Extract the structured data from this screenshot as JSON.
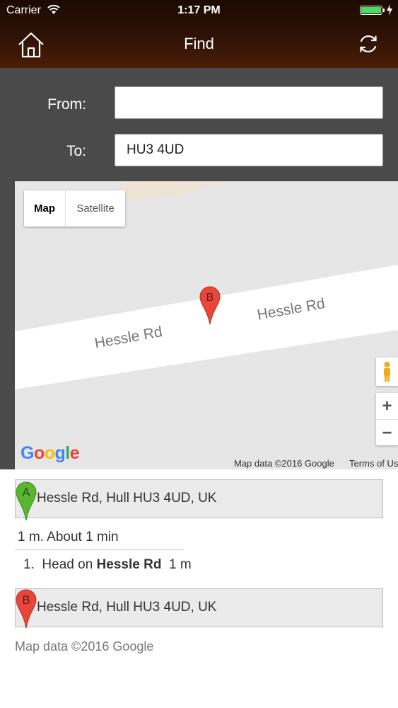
{
  "status_bar": {
    "carrier": "Carrier",
    "time": "1:17 PM",
    "battery_color": "#4cd964"
  },
  "nav": {
    "title": "Find",
    "home_icon": "home-icon",
    "refresh_icon": "refresh-icon"
  },
  "form": {
    "from_label": "From:",
    "from_value": "",
    "to_label": "To:",
    "to_value": "HU3 4UD"
  },
  "map": {
    "type_map": "Map",
    "type_satellite": "Satellite",
    "road_label_1": "Hessle Rd",
    "road_label_2": "Hessle Rd",
    "pin_label": "B",
    "logo": {
      "g1": "G",
      "o1": "o",
      "o2": "o",
      "g2": "g",
      "l": "l",
      "e": "e"
    },
    "attribution": "Map data ©2016 Google",
    "terms": "Terms of Us",
    "zoom_in": "+",
    "zoom_out": "−"
  },
  "directions": {
    "start": {
      "marker": "A",
      "address": "Hessle Rd, Hull HU3 4UD, UK",
      "color": "#5ab531"
    },
    "summary": "1 m. About 1 min",
    "steps": [
      {
        "number": "1.",
        "text": "Head on",
        "road": "Hessle Rd",
        "distance": "1 m"
      }
    ],
    "end": {
      "marker": "B",
      "address": "Hessle Rd, Hull HU3 4UD, UK",
      "color": "#e8463a"
    },
    "attribution": "Map data ©2016 Google"
  }
}
